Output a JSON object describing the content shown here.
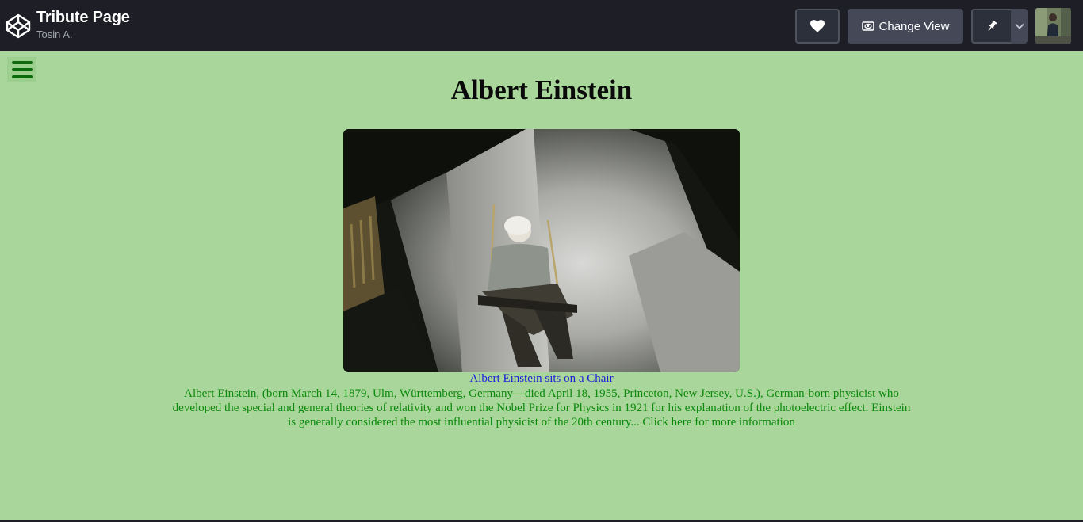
{
  "header": {
    "title": "Tribute Page",
    "author": "Tosin A.",
    "change_view_label": "Change View"
  },
  "content": {
    "heading": "Albert Einstein",
    "caption": "Albert Einstein sits on a Chair",
    "bio": "Albert Einstein, (born March 14, 1879, Ulm, Württemberg, Germany—died April 18, 1955, Princeton, New Jersey, U.S.), German-born physicist who developed the special and general theories of relativity and won the Nobel Prize for Physics in 1921 for his explanation of the photoelectric effect. Einstein is generally considered the most influential physicist of the 20th century...",
    "more_link": "Click here for more information"
  },
  "icons": {
    "logo": "codepen-logo-icon",
    "heart": "heart-icon",
    "view": "eye-icon",
    "pin": "pin-icon",
    "caret": "chevron-down-icon",
    "menu": "hamburger-menu-icon"
  },
  "colors": {
    "topbar": "#1e1f26",
    "page_background": "#a9d69a",
    "caption": "#1b1bd8",
    "bio_text": "#0b8a0b",
    "menu_icon": "#0b6b0b"
  }
}
